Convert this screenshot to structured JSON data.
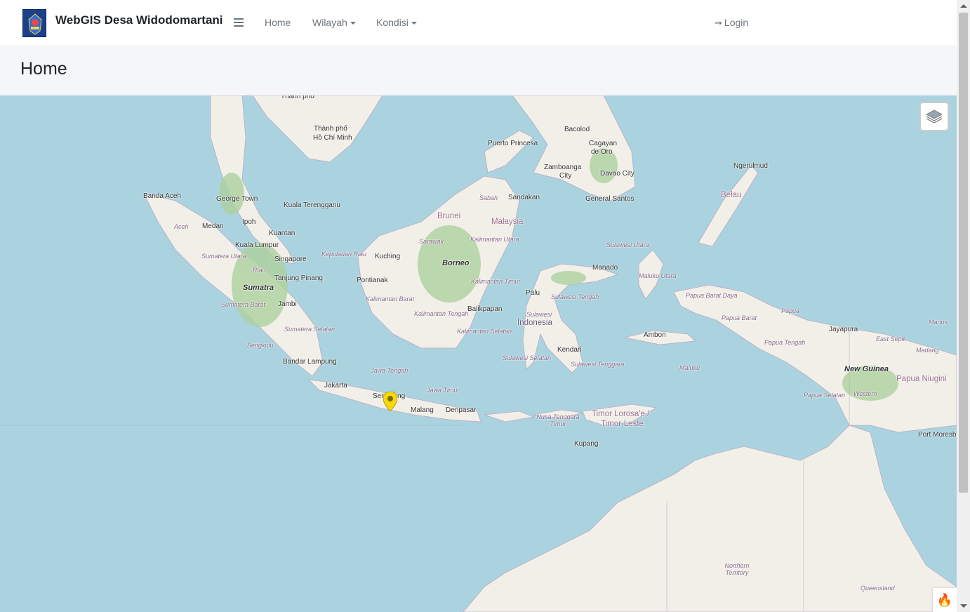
{
  "navbar": {
    "brand_title": "WebGIS Desa Widodomartani",
    "links": {
      "home": "Home",
      "wilayah": "Wilayah",
      "kondisi": "Kondisi",
      "login": "Login"
    }
  },
  "header": {
    "title": "Home"
  },
  "map": {
    "labels": {
      "thanh_pho_1": "Thành phố",
      "thanh_pho_2": "Hồ Chí Minh",
      "puerto_princesa": "Puerto Princesa",
      "bacolod": "Bacolod",
      "cagayan_1": "Cagayan",
      "cagayan_2": "de Oro",
      "zamboanga_1": "Zamboanga",
      "zamboanga_2": "City",
      "davao": "Davao City",
      "ngerulmud": "Ngerulmud",
      "banda_aceh": "Banda Aceh",
      "george_town": "George Town",
      "kuala_terengganu": "Kuala Terengganu",
      "sabah": "Sabah",
      "sandakan": "Sandakan",
      "general_santos": "General Santos",
      "belau": "Belau",
      "aceh": "Aceh",
      "medan": "Medan",
      "ipoh": "Ipoh",
      "kuantan": "Kuantan",
      "brunei": "Brunei",
      "malaysia": "Malaysia",
      "kuala_lumpur": "Kuala Lumpur",
      "sarawak": "Sarawak",
      "kalimantan_utara": "Kalimantan Utara",
      "sulawesi_utara": "Sulawesi Utara",
      "sumatera_utara": "Sumatera Utara",
      "singapore": "Singapore",
      "kepulauan_riau": "Kepulauan Riau",
      "kuching": "Kuching",
      "borneo": "Borneo",
      "manado": "Manado",
      "riau": "Riau",
      "sumatra": "Sumatra",
      "tanjung_pinang": "Tanjung Pinang",
      "pontianak": "Pontianak",
      "kalimantan_timur": "Kalimantan Timur",
      "maluku_utara": "Maluku Utara",
      "palu": "Palu",
      "sulawesi_tengah": "Sulawesi Tengah",
      "papua_barat_daya": "Papua Barat Daya",
      "jambi": "Jambi",
      "sumatera_barat": "Sumatera Barat",
      "kalimantan_barat": "Kalimantan Barat",
      "balikpapan": "Balikpapan",
      "sulawesi": "Sulawesi",
      "indonesia": "Indonesia",
      "papua_barat": "Papua Barat",
      "papua": "Papua",
      "kalimantan_tengah": "Kalimantan Tengah",
      "ambon": "Ambon",
      "jayapura": "Jayapura",
      "manus": "Manus",
      "sumatera_selatan": "Sumatera Selatan",
      "kalimantan_selatan": "Kalimantan Selatan",
      "kendari": "Kendari",
      "papua_tengah": "Papua Tengah",
      "east_sepik": "East Sepik",
      "bengkulu": "Bengkulu",
      "madang": "Madang",
      "bandar_lampung": "Bandar Lampung",
      "sulawesi_selatan": "Sulawesi Selatan",
      "sulawesi_tenggara": "Sulawesi Tenggara",
      "maluku": "Maluku",
      "new_guinea": "New Guinea",
      "jawa_tengah": "Jawa Tengah",
      "papua_niugini": "Papua Niugini",
      "jakarta": "Jakarta",
      "jawa_timur": "Jawa Timur",
      "semarang": "Semarang",
      "papua_selatan": "Papua Selatan",
      "western": "Western",
      "malang": "Malang",
      "denpasar": "Denpasar",
      "nusa_tenggara_timur": "Nusa Tenggara Timur",
      "timor_1": "Timor Lorosa'e /",
      "timor_2": "Timor-Leste",
      "port_moresby": "Port Moresby",
      "kupang": "Kupang",
      "northern_territory": "Northern Territory",
      "queensland": "Queensland"
    }
  },
  "icons": {
    "layers": "layers-icon",
    "marker": "map-marker-icon",
    "login": "sign-in-icon",
    "hamburger": "hamburger-icon",
    "fire": "fire-icon"
  },
  "colors": {
    "water": "#aad3df",
    "land": "#f2efe9",
    "forest": "#add19e",
    "marker": "#f5d90a"
  }
}
